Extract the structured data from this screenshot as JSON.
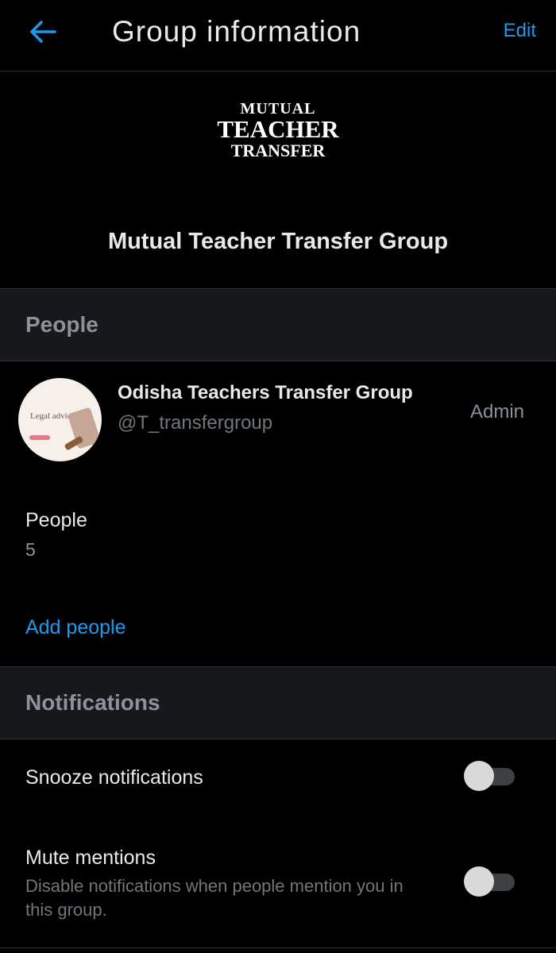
{
  "header": {
    "title": "Group information",
    "edit_label": "Edit"
  },
  "group": {
    "logo_lines": [
      "MUTUAL",
      "TEACHER",
      "TRANSFER"
    ],
    "name": "Mutual Teacher Transfer Group"
  },
  "people_section": {
    "header": "People",
    "members": [
      {
        "name": "Odisha Teachers Transfer Group",
        "handle": "@T_transfergroup",
        "role": "Admin",
        "avatar_text": "Legal advice"
      }
    ],
    "count_label": "People",
    "count_value": "5",
    "add_label": "Add people"
  },
  "notifications_section": {
    "header": "Notifications",
    "snooze_label": "Snooze notifications",
    "snooze_enabled": false,
    "mute_label": "Mute mentions",
    "mute_description": "Disable notifications when people mention you in this group.",
    "mute_enabled": false
  },
  "colors": {
    "accent": "#1d9bf0",
    "background": "#000000",
    "section_bg": "#16181c"
  }
}
